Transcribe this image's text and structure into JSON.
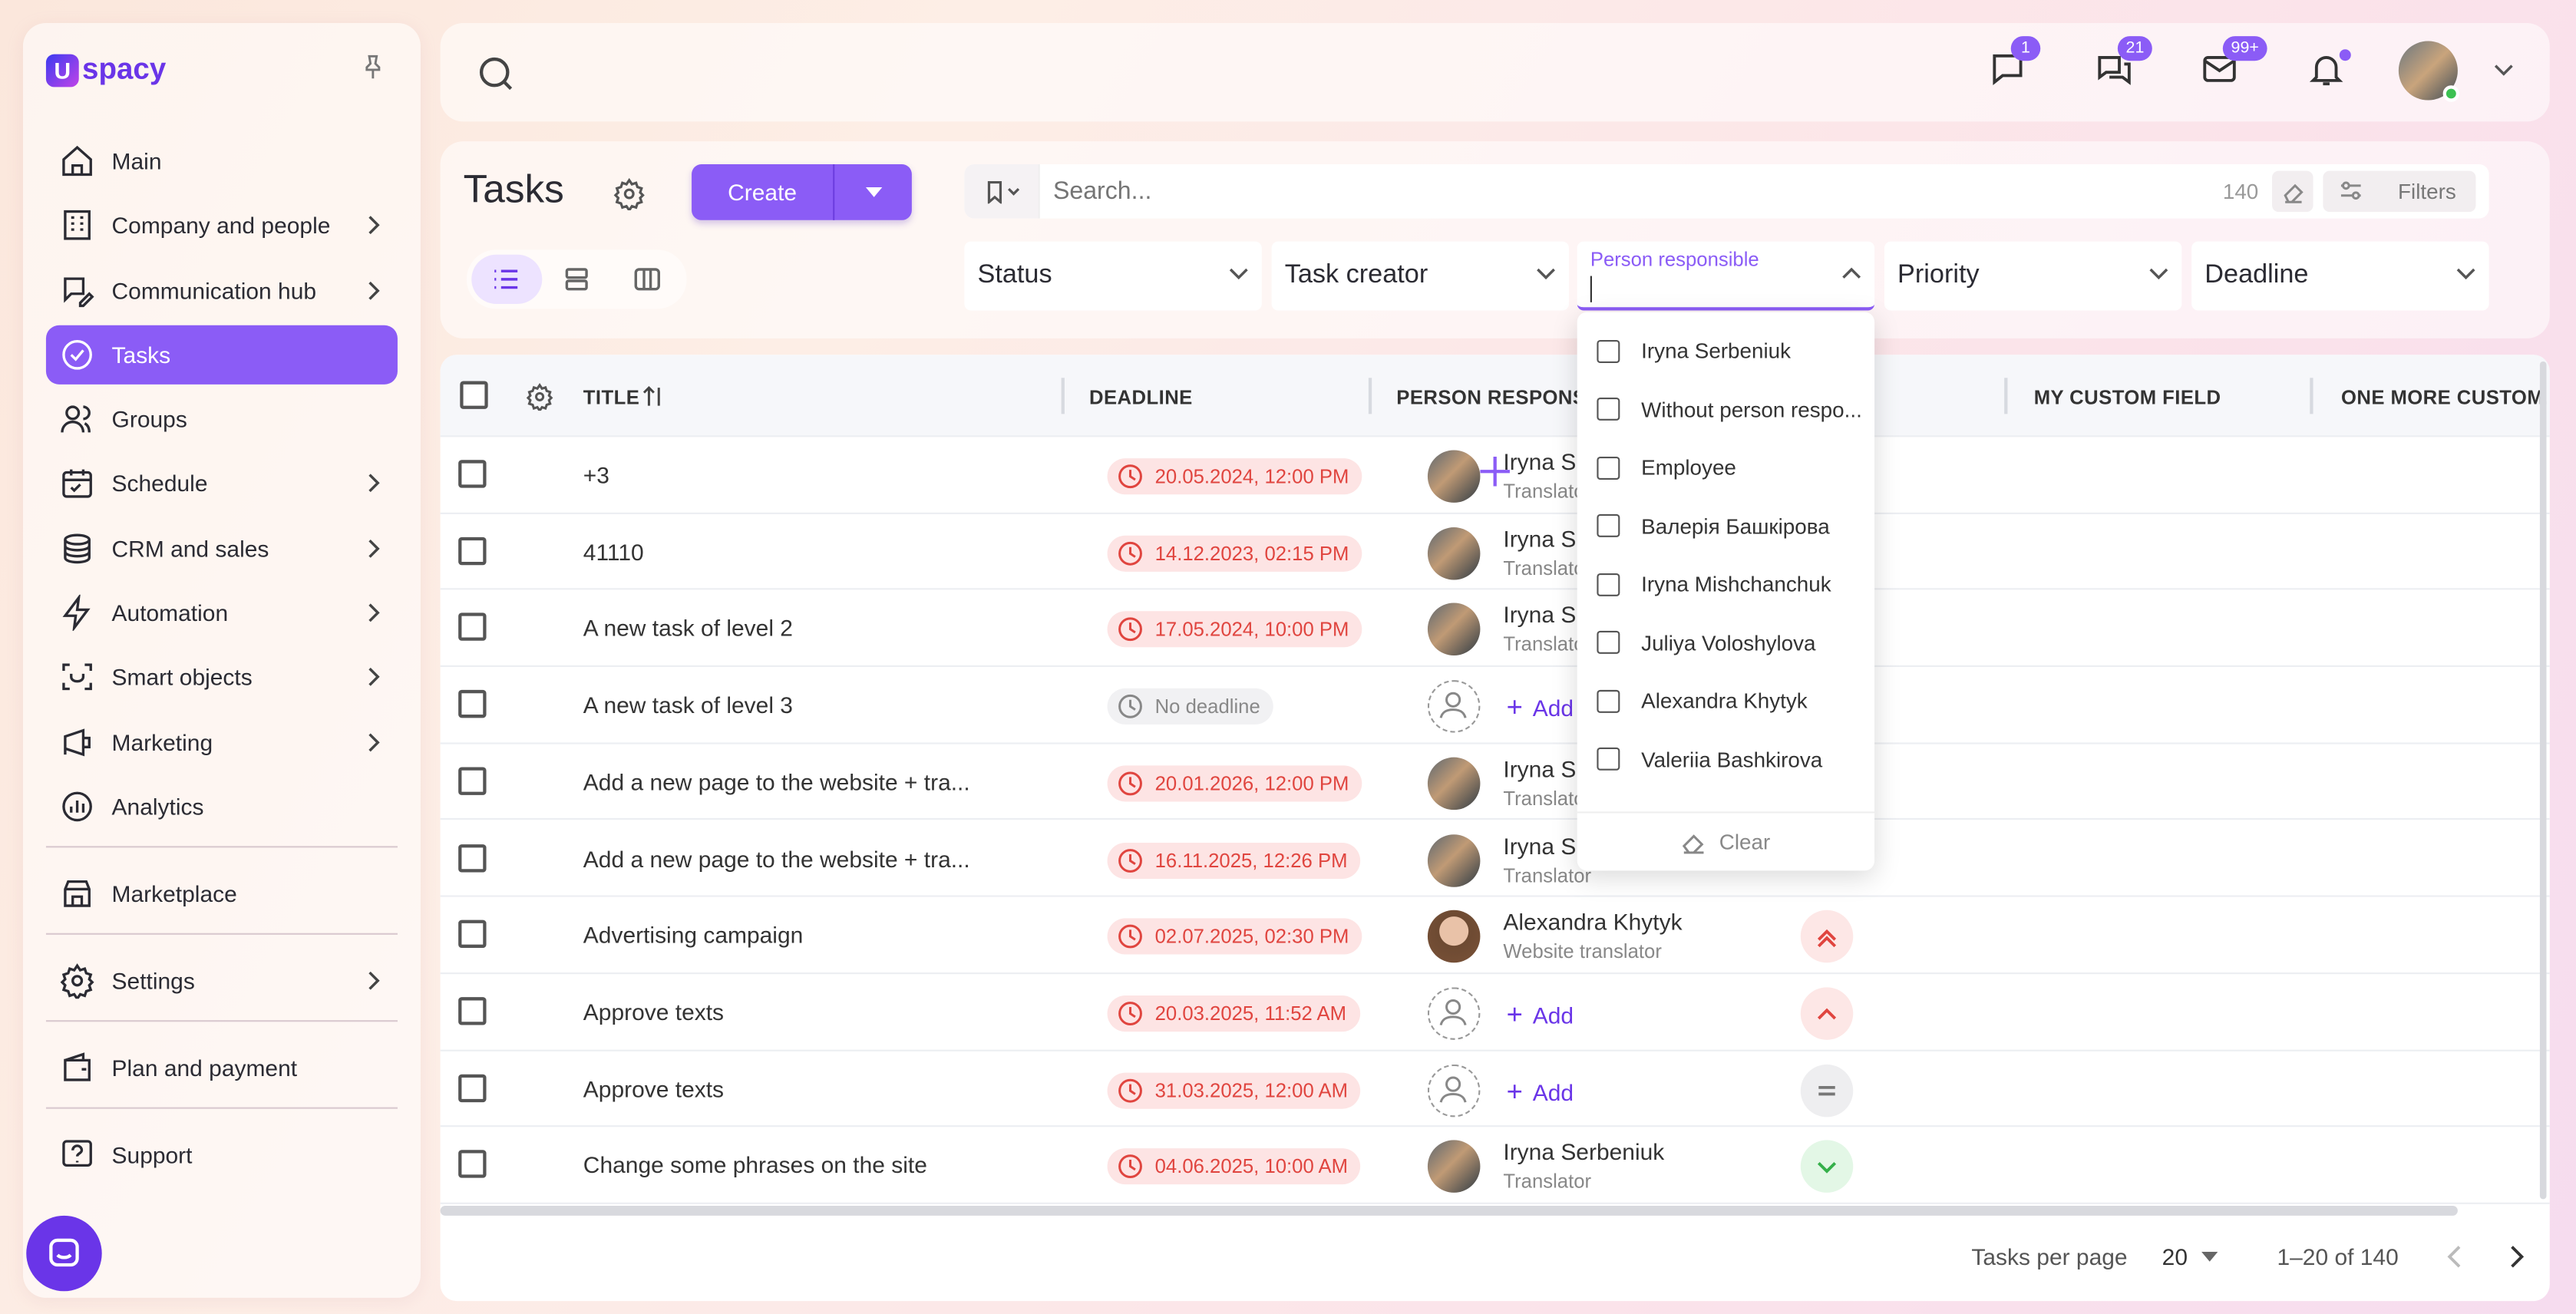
{
  "brand": {
    "name": "spacy",
    "mark": "U"
  },
  "sidebar": {
    "items": [
      {
        "label": "Main",
        "icon": "home-icon",
        "chevron": false
      },
      {
        "label": "Company and people",
        "icon": "building-icon",
        "chevron": true
      },
      {
        "label": "Communication hub",
        "icon": "chat-edit-icon",
        "chevron": true
      },
      {
        "label": "Tasks",
        "icon": "check-circle-icon",
        "chevron": false,
        "active": true
      },
      {
        "label": "Groups",
        "icon": "people-icon",
        "chevron": false
      },
      {
        "label": "Schedule",
        "icon": "calendar-icon",
        "chevron": true
      },
      {
        "label": "CRM and sales",
        "icon": "coins-icon",
        "chevron": true
      },
      {
        "label": "Automation",
        "icon": "lightning-icon",
        "chevron": true
      },
      {
        "label": "Smart objects",
        "icon": "scan-icon",
        "chevron": true
      },
      {
        "label": "Marketing",
        "icon": "marketing-icon",
        "chevron": true
      },
      {
        "label": "Analytics",
        "icon": "chart-icon",
        "chevron": false
      }
    ],
    "marketplace": "Marketplace",
    "settings": "Settings",
    "plan": "Plan and payment",
    "support": "Support"
  },
  "topbar": {
    "badges": {
      "messages": "1",
      "chats": "21",
      "mail": "99+"
    }
  },
  "page": {
    "title": "Tasks",
    "create": "Create"
  },
  "search": {
    "placeholder": "Search...",
    "count": "140",
    "filters": "Filters"
  },
  "filters": {
    "status": "Status",
    "creator": "Task creator",
    "responsible_label": "Person responsible",
    "priority": "Priority",
    "deadline": "Deadline"
  },
  "table": {
    "headers": {
      "title": "TITLE",
      "deadline": "DEADLINE",
      "person": "PERSON RESPONSIBLE",
      "custom1": "MY CUSTOM FIELD",
      "custom2": "ONE MORE CUSTOM..."
    },
    "add": "Add",
    "rows": [
      {
        "title": "+3",
        "deadline": "20.05.2024, 12:00 PM",
        "person": "Iryna S",
        "role": "Translator",
        "av": "m",
        "prio": ""
      },
      {
        "title": "41110",
        "deadline": "14.12.2023, 02:15 PM",
        "person": "Iryna S",
        "role": "Translator",
        "av": "m",
        "prio": ""
      },
      {
        "title": "A new task of level 2",
        "deadline": "17.05.2024, 10:00 PM",
        "person": "Iryna S",
        "role": "Translator",
        "av": "m",
        "prio": ""
      },
      {
        "title": "A new task of level 3",
        "deadline": "No deadline",
        "person": "",
        "role": "",
        "av": "empty",
        "prio": ""
      },
      {
        "title": "Add a new page to the website + tra...",
        "deadline": "20.01.2026, 12:00 PM",
        "person": "Iryna S",
        "role": "Translator",
        "av": "m",
        "prio": ""
      },
      {
        "title": "Add a new page to the website + tra...",
        "deadline": "16.11.2025, 12:26 PM",
        "person": "Iryna S",
        "role": "Translator",
        "av": "m",
        "prio": ""
      },
      {
        "title": "Advertising campaign",
        "deadline": "02.07.2025, 02:30 PM",
        "person": "Alexandra Khytyk",
        "role": "Website translator",
        "av": "f",
        "prio": "highest"
      },
      {
        "title": "Approve texts",
        "deadline": "20.03.2025, 11:52 AM",
        "person": "",
        "role": "",
        "av": "empty",
        "prio": "high"
      },
      {
        "title": "Approve texts",
        "deadline": "31.03.2025, 12:00 AM",
        "person": "",
        "role": "",
        "av": "empty",
        "prio": "medium"
      },
      {
        "title": "Change some phrases on the site",
        "deadline": "04.06.2025, 10:00 AM",
        "person": "Iryna Serbeniuk",
        "role": "Translator",
        "av": "m",
        "prio": "low"
      }
    ]
  },
  "dropdown": {
    "options": [
      "Iryna Serbeniuk",
      "Without person respo...",
      "Employee",
      "Валерія Башкірова",
      "Iryna Mishchanchuk",
      "Juliya Voloshylova",
      "Alexandra Khytyk",
      "Valeriia Bashkirova"
    ],
    "clear": "Clear"
  },
  "footer": {
    "per_page_label": "Tasks per page",
    "per_page": "20",
    "range": "1–20 of 140"
  }
}
